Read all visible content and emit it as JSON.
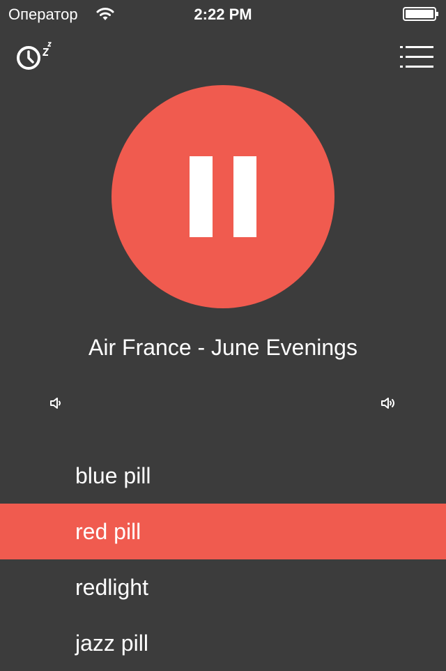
{
  "status_bar": {
    "carrier": "Оператор",
    "time": "2:22 PM",
    "wifi_icon": "wifi-icon",
    "battery_icon": "battery-full-icon"
  },
  "toolbar": {
    "sleep_timer_icon": "sleep-timer-icon",
    "menu_icon": "menu-list-icon"
  },
  "player": {
    "state": "playing",
    "control_icon": "pause-icon",
    "now_playing": "Air France - June Evenings",
    "volume_min_icon": "volume-low-icon",
    "volume_max_icon": "volume-high-icon"
  },
  "stations": [
    {
      "label": "blue pill",
      "active": false
    },
    {
      "label": "red pill",
      "active": true
    },
    {
      "label": "redlight",
      "active": false
    },
    {
      "label": "jazz pill",
      "active": false
    }
  ],
  "colors": {
    "background": "#3c3c3c",
    "accent": "#f05b4f",
    "text": "#ffffff"
  }
}
